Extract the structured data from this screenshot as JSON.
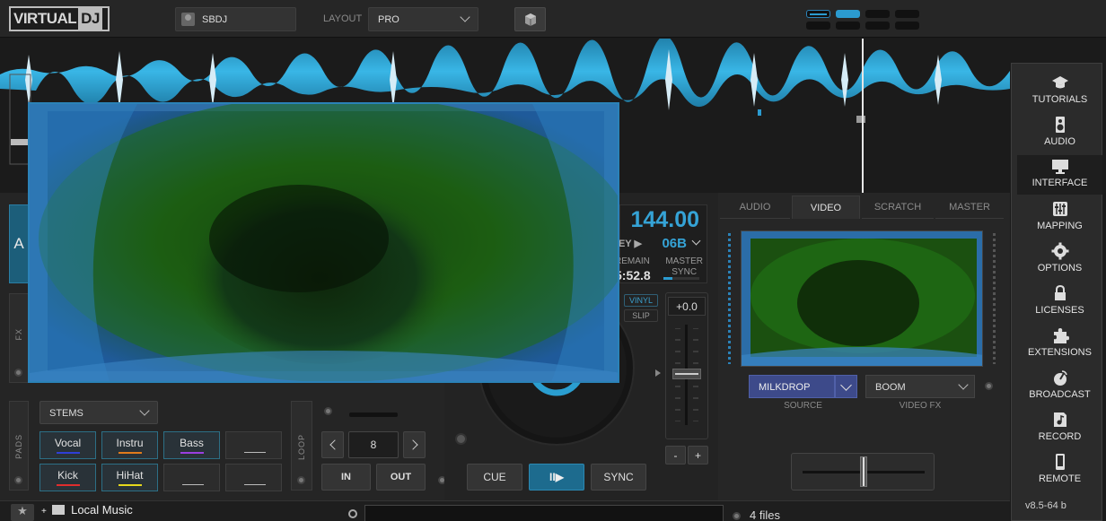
{
  "topbar": {
    "logo_left": "VIRTUAL",
    "logo_right": "DJ",
    "user": "SBDJ",
    "layout_label": "LAYOUT",
    "layout_value": "PRO"
  },
  "deck": {
    "deck_letter": "A",
    "fx_label": "FX",
    "pads_label": "PADS",
    "loop_label": "LOOP",
    "pads_mode": "STEMS",
    "pads": [
      {
        "label": "Vocal",
        "color": "#2f3fd6"
      },
      {
        "label": "Instru",
        "color": "#e07b1c"
      },
      {
        "label": "Bass",
        "color": "#9a3fe0"
      },
      {
        "label": "",
        "color": ""
      },
      {
        "label": "Kick",
        "color": "#e02d2d"
      },
      {
        "label": "HiHat",
        "color": "#e6d81c"
      },
      {
        "label": "",
        "color": ""
      },
      {
        "label": "",
        "color": ""
      }
    ],
    "loop_size": "8",
    "loop_in": "IN",
    "loop_out": "OUT",
    "bpm": "144.00",
    "key_label": "KEY",
    "key": "06B",
    "remain_label": "REMAIN",
    "remain": "5:52.8",
    "master_label": "MASTER",
    "sync_label": "SYNC",
    "vinyl": "VINYL",
    "slip": "SLIP",
    "pitch": "+0.0",
    "pitch_minus": "-",
    "pitch_plus": "+",
    "cue": "CUE",
    "play": "II▶",
    "sync": "SYNC"
  },
  "right_panel": {
    "tabs": [
      "AUDIO",
      "VIDEO",
      "SCRATCH",
      "MASTER"
    ],
    "active_tab": "VIDEO",
    "source": "MILKDROP",
    "source_label": "SOURCE",
    "video_fx": "BOOM",
    "video_fx_label": "VIDEO FX"
  },
  "settings_menu": {
    "items": [
      {
        "label": "TUTORIALS",
        "icon": "graduation-cap-icon"
      },
      {
        "label": "AUDIO",
        "icon": "speaker-icon"
      },
      {
        "label": "INTERFACE",
        "icon": "monitor-icon"
      },
      {
        "label": "MAPPING",
        "icon": "sliders-icon"
      },
      {
        "label": "OPTIONS",
        "icon": "gear-icon"
      },
      {
        "label": "LICENSES",
        "icon": "lock-icon"
      },
      {
        "label": "EXTENSIONS",
        "icon": "puzzle-icon"
      },
      {
        "label": "BROADCAST",
        "icon": "broadcast-icon"
      },
      {
        "label": "RECORD",
        "icon": "record-icon"
      },
      {
        "label": "REMOTE",
        "icon": "phone-icon"
      }
    ],
    "active": "INTERFACE",
    "version": "v8.5-64 b"
  },
  "browser": {
    "folder": "Local Music",
    "expand": "+",
    "files": "4 files"
  },
  "colors": {
    "accent": "#35a3d6",
    "waveform": "#2b9bd0",
    "video_border": "#2b82b8"
  }
}
